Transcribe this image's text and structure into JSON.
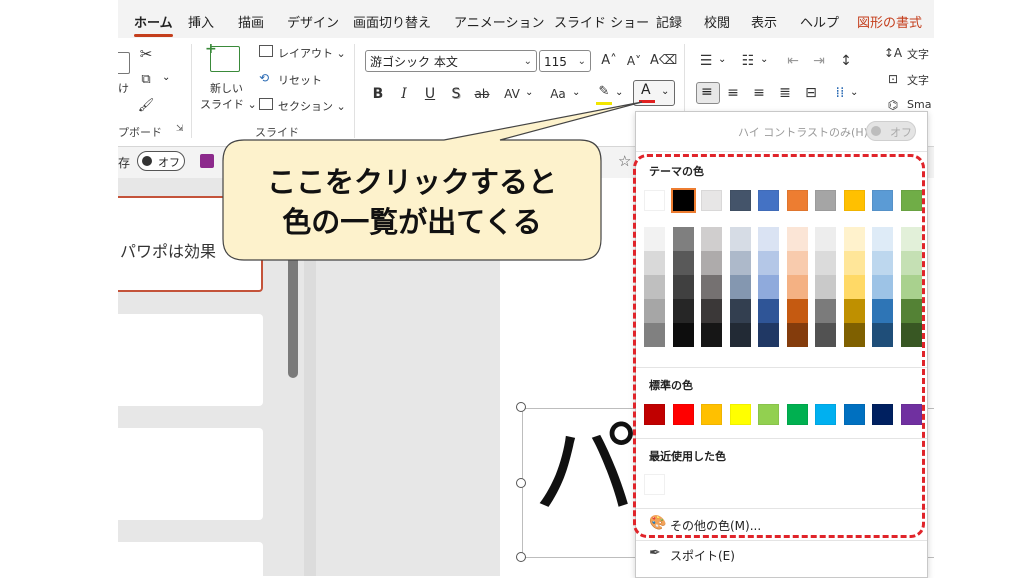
{
  "tabs": [
    "ホーム",
    "挿入",
    "描画",
    "デザイン",
    "画面切り替え",
    "アニメーション",
    "スライド ショー",
    "記録",
    "校閲",
    "表示",
    "ヘルプ",
    "図形の書式"
  ],
  "clipboard": {
    "paste_fragment": "け",
    "group_label": "プボード"
  },
  "slides_group": {
    "new_slide_line1": "新しい",
    "new_slide_line2": "スライド ⌄",
    "layout": "レイアウト ⌄",
    "reset": "リセット",
    "section": "セクション ⌄",
    "group_label": "スライド"
  },
  "font": {
    "name": "游ゴシック 本文",
    "size": "115",
    "bold": "B",
    "italic": "I",
    "underline": "U",
    "shadow": "S",
    "strike": "ab",
    "spacing": "AV",
    "case": "Aa",
    "font_color_letter": "A",
    "font_color_value": "#e02020",
    "highlight_color_value": "#f2e600"
  },
  "paragraph": {
    "text_direction": "文字",
    "align_text": "文字",
    "smartart": "Sma"
  },
  "qat": {
    "autosave_fragment": "存",
    "autosave_state": "オフ"
  },
  "slide_thumb_text": "パワポは効果",
  "canvas_text": "パ",
  "dropdown": {
    "high_contrast_label": "ハイ コントラストのみ(H)",
    "high_contrast_state": "オフ",
    "theme_title": "テーマの色",
    "theme_top": [
      "#ffffff",
      "#000000",
      "#e7e6e6",
      "#44546a",
      "#4472c4",
      "#ed7d31",
      "#a5a5a5",
      "#ffc000",
      "#5b9bd5",
      "#70ad47"
    ],
    "theme_shades": [
      [
        "#f2f2f2",
        "#d9d9d9",
        "#bfbfbf",
        "#a6a6a6",
        "#808080"
      ],
      [
        "#7f7f7f",
        "#595959",
        "#404040",
        "#262626",
        "#0d0d0d"
      ],
      [
        "#d0cece",
        "#aeabab",
        "#757171",
        "#3b3838",
        "#161616"
      ],
      [
        "#d6dce5",
        "#adb9ca",
        "#8497b0",
        "#333f50",
        "#222a35"
      ],
      [
        "#dae3f3",
        "#b4c7e7",
        "#8faadc",
        "#2f5597",
        "#203864"
      ],
      [
        "#fbe5d6",
        "#f8cbad",
        "#f4b183",
        "#c55a11",
        "#843c0c"
      ],
      [
        "#ededed",
        "#dbdbdb",
        "#c9c9c9",
        "#7b7b7b",
        "#525252"
      ],
      [
        "#fff2cc",
        "#ffe699",
        "#ffd966",
        "#bf9000",
        "#7f6000"
      ],
      [
        "#deebf7",
        "#bdd7ee",
        "#9dc3e6",
        "#2e75b6",
        "#1f4e79"
      ],
      [
        "#e2f0d9",
        "#c5e0b4",
        "#a9d18e",
        "#548235",
        "#385723"
      ]
    ],
    "standard_title": "標準の色",
    "standard_colors": [
      "#c00000",
      "#ff0000",
      "#ffc000",
      "#ffff00",
      "#92d050",
      "#00b050",
      "#00b0f0",
      "#0070c0",
      "#002060",
      "#7030a0"
    ],
    "recent_title": "最近使用した色",
    "recent_colors": [
      "#ffffff"
    ],
    "more_colors": "その他の色(M)...",
    "eyedropper": "スポイト(E)"
  },
  "annotation": {
    "text": "ここをクリックすると\n色の一覧が出てくる",
    "fill": "#fdf2cc",
    "highlight_color": "#e0242a"
  }
}
